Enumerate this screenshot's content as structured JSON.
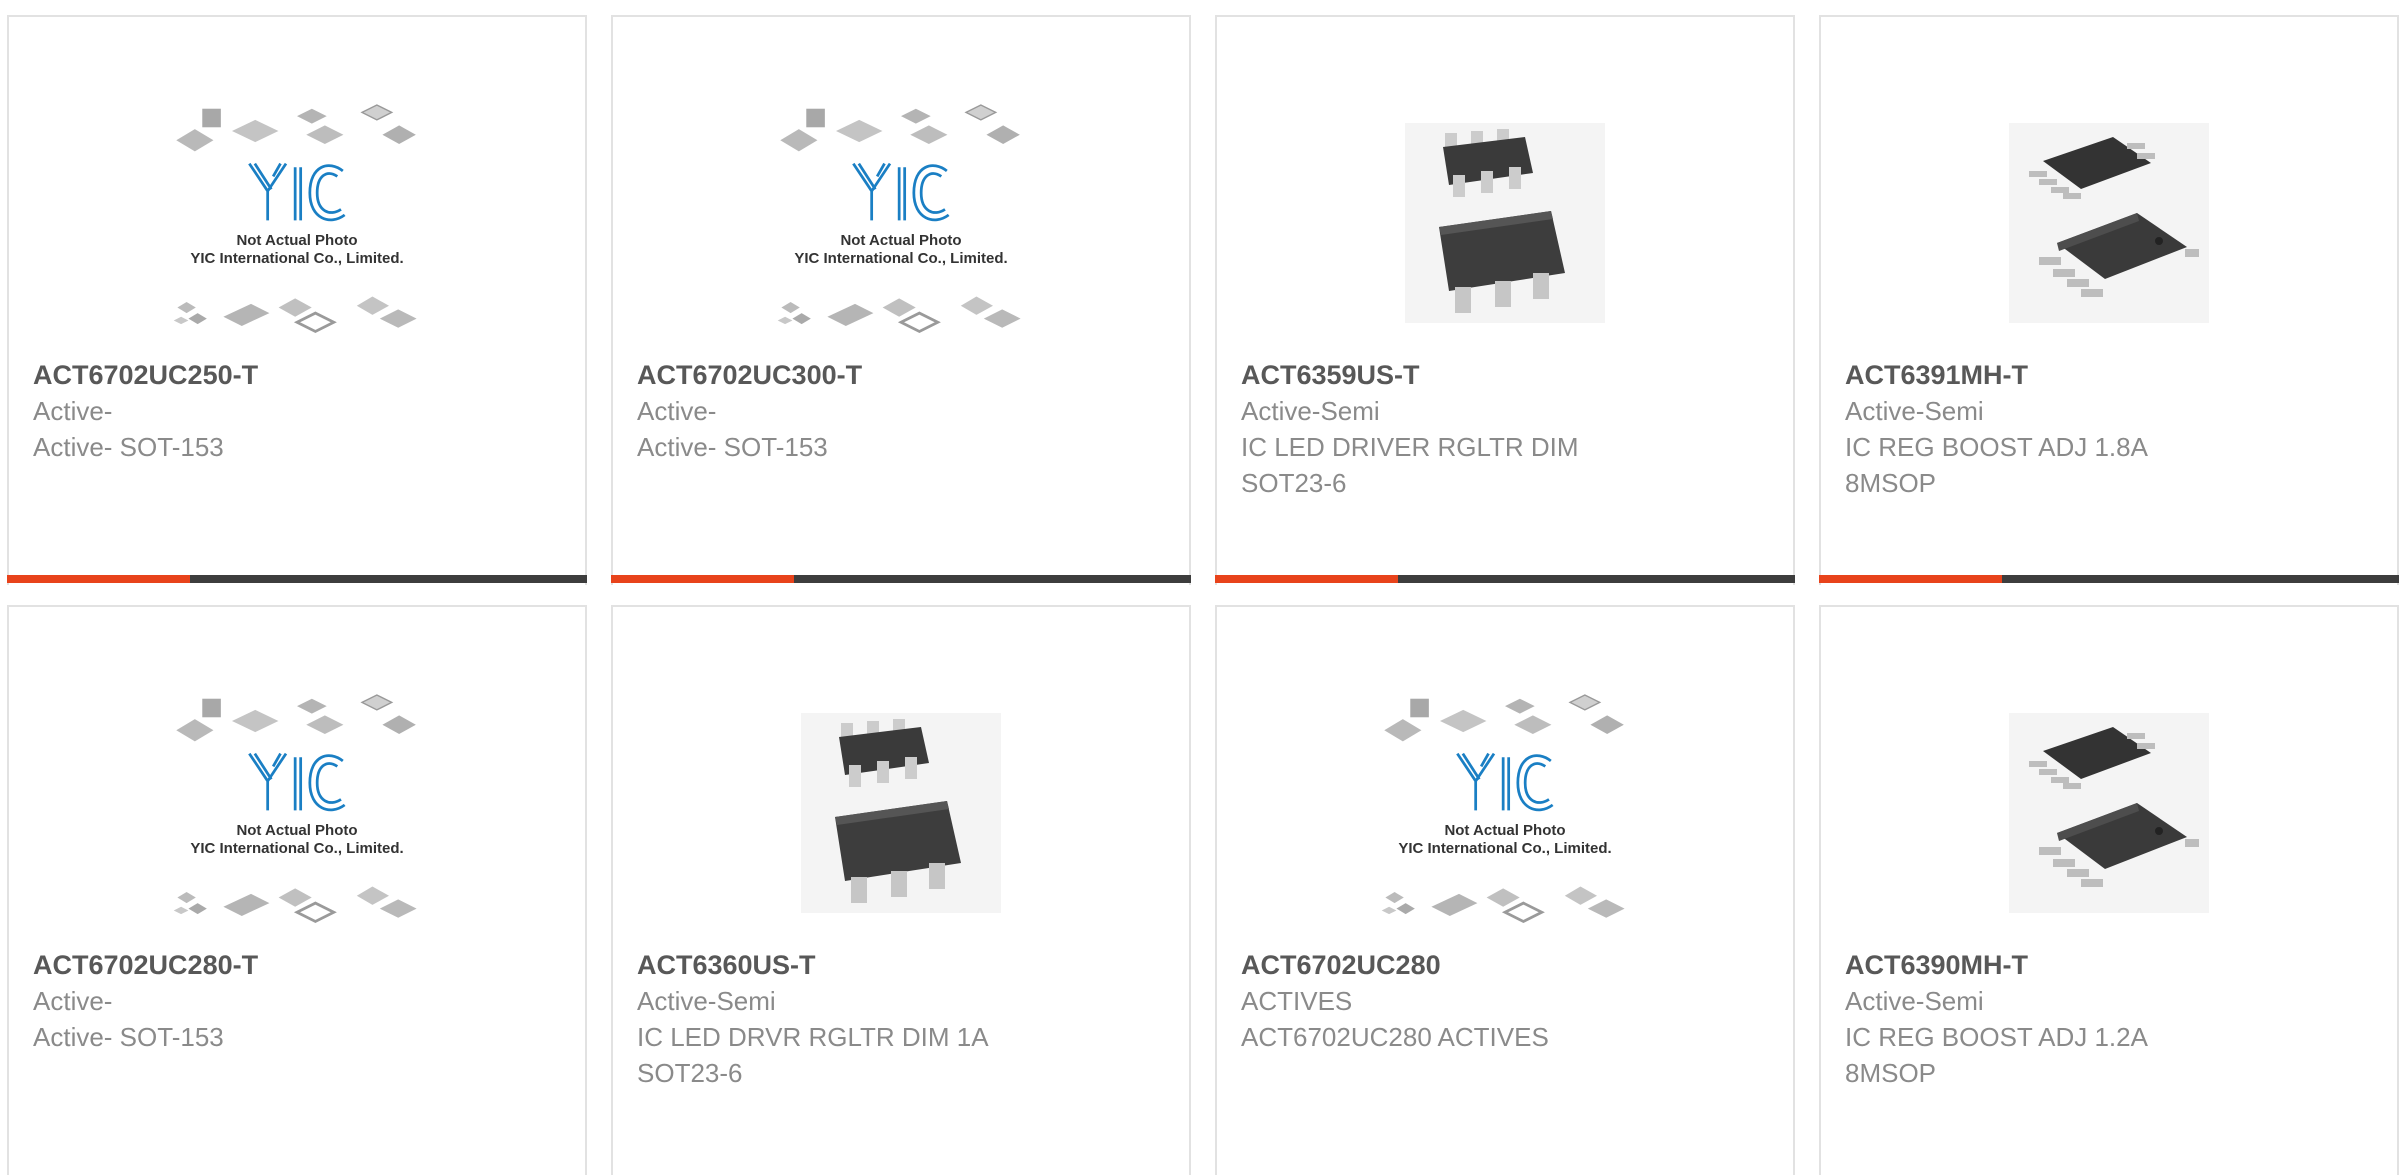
{
  "colors": {
    "accent": "#e8431b",
    "bar_dark": "#3d3d3d",
    "yic_blue": "#1a7fc4"
  },
  "placeholder": {
    "line1": "Not Actual Photo",
    "line2": "YIC International Co., Limited."
  },
  "products": [
    {
      "part": "ACT6702UC250-T",
      "manufacturer": "Active-",
      "description": "Active- SOT-153",
      "image": "yic-placeholder-icon"
    },
    {
      "part": "ACT6702UC300-T",
      "manufacturer": "Active-",
      "description": "Active- SOT-153",
      "image": "yic-placeholder-icon"
    },
    {
      "part": "ACT6359US-T",
      "manufacturer": "Active-Semi",
      "description": "IC LED DRIVER RGLTR DIM\nSOT23-6",
      "image": "sot23-chip-icon"
    },
    {
      "part": "ACT6391MH-T",
      "manufacturer": "Active-Semi",
      "description": "IC REG BOOST ADJ 1.8A\n8MSOP",
      "image": "msop-chip-icon"
    },
    {
      "part": "ACT6702UC280-T",
      "manufacturer": "Active-",
      "description": "Active- SOT-153",
      "image": "yic-placeholder-icon"
    },
    {
      "part": "ACT6360US-T",
      "manufacturer": "Active-Semi",
      "description": "IC LED DRVR RGLTR DIM 1A\nSOT23-6",
      "image": "sot23-chip-icon"
    },
    {
      "part": "ACT6702UC280",
      "manufacturer": "ACTIVES",
      "description": "ACT6702UC280 ACTIVES",
      "image": "yic-placeholder-icon"
    },
    {
      "part": "ACT6390MH-T",
      "manufacturer": "Active-Semi",
      "description": "IC REG BOOST ADJ 1.2A\n8MSOP",
      "image": "msop-chip-icon"
    }
  ]
}
